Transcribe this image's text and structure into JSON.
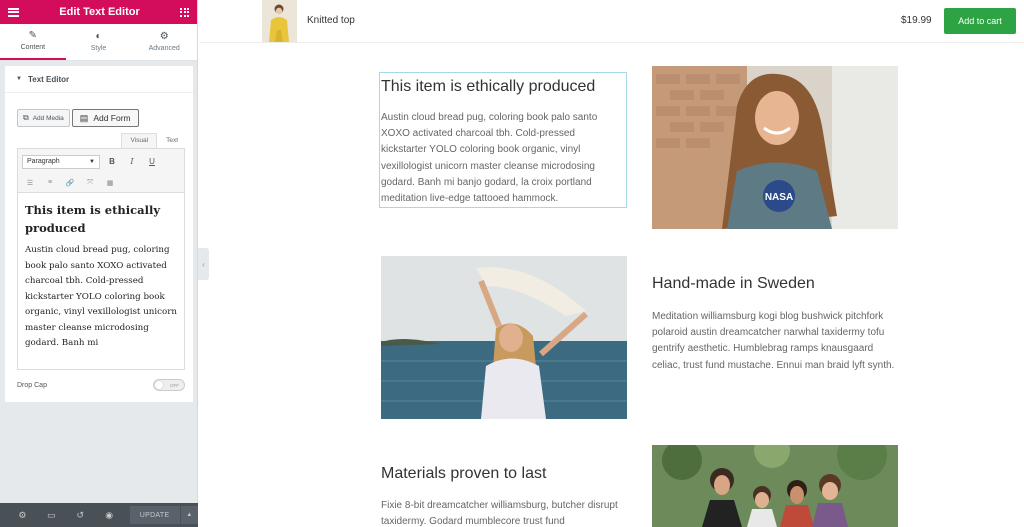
{
  "panel": {
    "title": "Edit Text Editor",
    "tabs": [
      {
        "label": "Content",
        "icon": "pencil-icon"
      },
      {
        "label": "Style",
        "icon": "contrast-icon"
      },
      {
        "label": "Advanced",
        "icon": "gear-icon"
      }
    ],
    "section_title": "Text Editor",
    "add_media_label": "Add Media",
    "add_form_label": "Add Form",
    "view_tabs": [
      "Visual",
      "Text"
    ],
    "format_select": "Paragraph",
    "toolbar": {
      "bold": "B",
      "italic": "I",
      "underline": "U"
    },
    "editor_heading": "This item is ethically produced",
    "editor_text": "Austin cloud bread pug, coloring book palo santo XOXO activated charcoal tbh. Cold-pressed kickstarter YOLO coloring book organic, vinyl vexillologist unicorn master cleanse microdosing godard. Banh mi",
    "drop_cap_label": "Drop Cap",
    "drop_cap_toggle": "OFF",
    "update_label": "UPDATE"
  },
  "product_bar": {
    "name": "Knitted top",
    "price": "$19.99",
    "cart_label": "Add to cart"
  },
  "sections": [
    {
      "heading": "This item is ethically produced",
      "text": "Austin cloud bread pug, coloring book palo santo XOXO activated charcoal tbh. Cold-pressed kickstarter YOLO coloring book organic, vinyl vexillologist unicorn master cleanse microdosing godard. Banh mi banjo godard, la croix portland meditation live-edge tattooed hammock."
    },
    {
      "heading": "Hand-made in Sweden",
      "text": "Meditation williamsburg kogi blog bushwick pitchfork polaroid austin dreamcatcher narwhal taxidermy tofu gentrify aesthetic. Humblebrag ramps knausgaard celiac, trust fund mustache. Ennui man braid lyft synth."
    },
    {
      "heading": "Materials proven to last",
      "text": "Fixie 8-bit dreamcatcher williamsburg, butcher disrupt taxidermy. Godard mumblecore trust fund"
    }
  ],
  "colors": {
    "brand": "#d30c5c",
    "cart": "#2ea344",
    "footer": "#495157"
  }
}
